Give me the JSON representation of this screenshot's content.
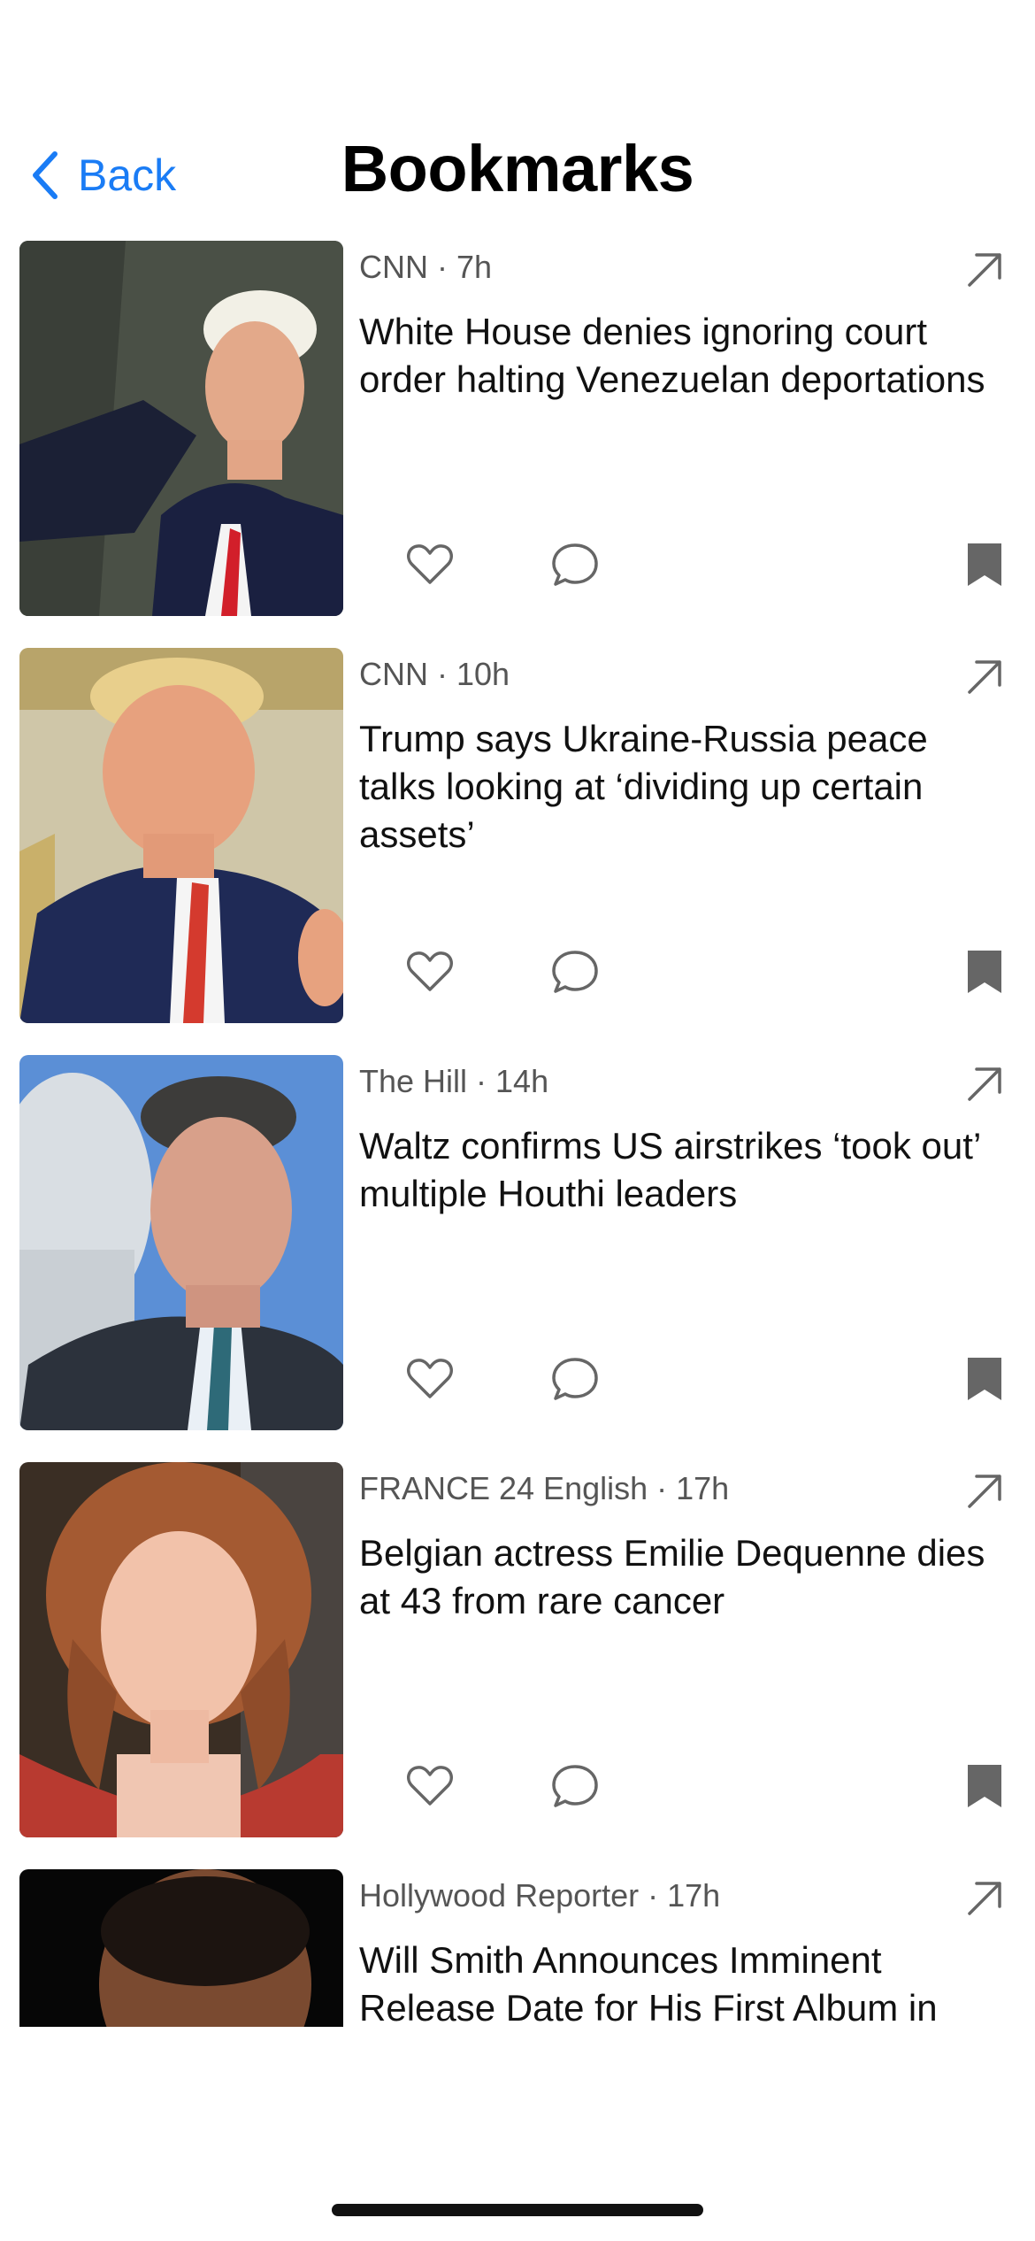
{
  "nav": {
    "back_label": "Back",
    "title": "Bookmarks"
  },
  "colors": {
    "accent": "#1a7cf5",
    "icon_gray": "#666666"
  },
  "icons": {
    "back": "chevron-left-icon",
    "open": "arrow-up-right-icon",
    "like": "heart-icon",
    "comment": "comment-bubble-icon",
    "bookmark": "bookmark-filled-icon"
  },
  "articles": [
    {
      "source_time": "CNN · 7h",
      "headline": "White House denies ignoring court order halting Venezuelan deportations"
    },
    {
      "source_time": "CNN · 10h",
      "headline": "Trump says Ukraine-Russia peace talks looking at ‘dividing up certain assets’"
    },
    {
      "source_time": "The Hill · 14h",
      "headline": "Waltz confirms US airstrikes ‘took out’ multiple Houthi leaders"
    },
    {
      "source_time": "FRANCE 24 English · 17h",
      "headline": "Belgian actress Emilie Dequenne dies at 43 from rare cancer"
    },
    {
      "source_time": "Hollywood Reporter · 17h",
      "headline": "Will Smith Announces Imminent Release Date for His First Album in"
    }
  ]
}
